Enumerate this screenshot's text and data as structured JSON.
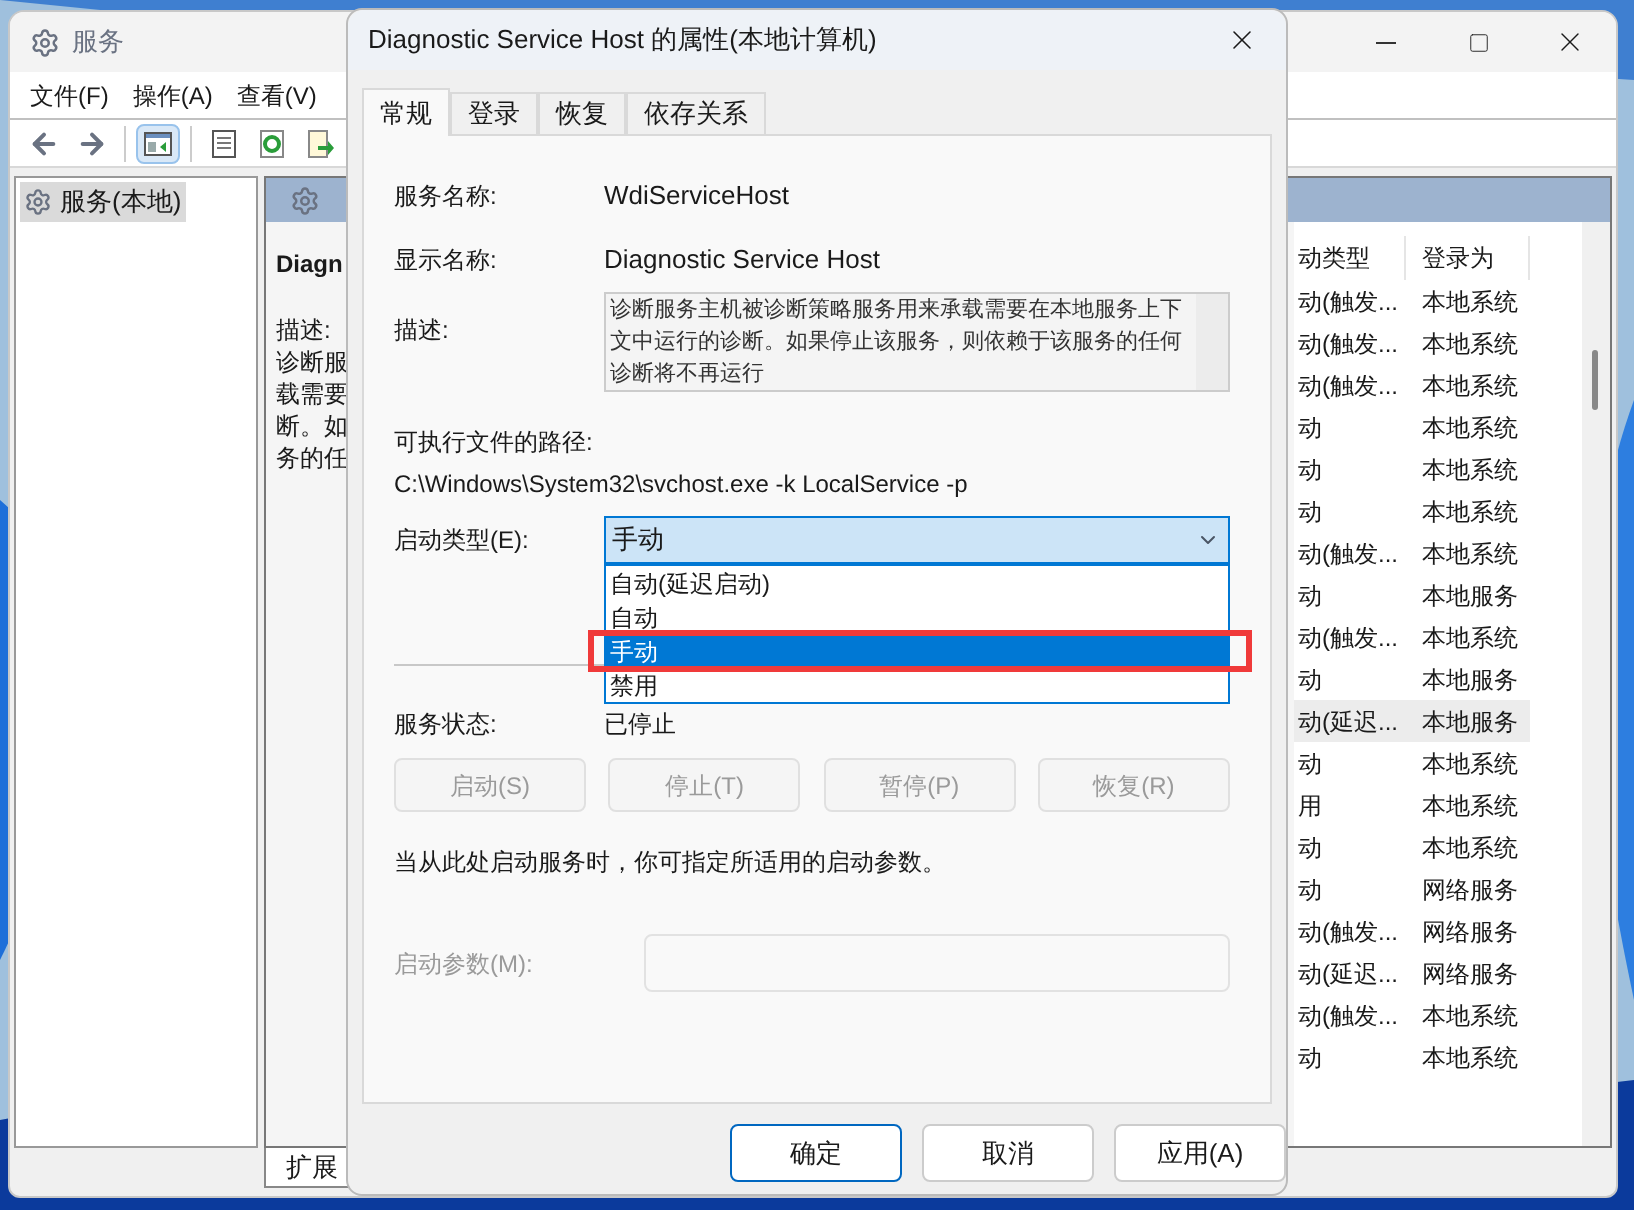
{
  "services_window": {
    "title": "服务",
    "menu": [
      "文件(F)",
      "操作(A)",
      "查看(V)"
    ],
    "toolbar": [
      {
        "kind": "back",
        "pressed": false
      },
      {
        "kind": "forward",
        "pressed": false
      },
      {
        "kind": "tree",
        "pressed": true
      },
      {
        "kind": "properties",
        "pressed": false
      },
      {
        "kind": "refresh",
        "pressed": false
      },
      {
        "kind": "export",
        "pressed": false
      }
    ],
    "tree": [
      {
        "label": "服务(本地)",
        "selected": true
      }
    ],
    "detail": {
      "title": "Diagn",
      "lines": [
        "描述:",
        "诊断服",
        "载需要",
        "断。如",
        "务的任"
      ]
    },
    "list": {
      "columns": [
        "动类型",
        "登录为"
      ],
      "rows": [
        {
          "column_1": "动(触发...",
          "logon": "本地系统",
          "selected": false
        },
        {
          "column_1": "动(触发...",
          "logon": "本地系统",
          "selected": false
        },
        {
          "column_1": "动(触发...",
          "logon": "本地系统",
          "selected": false
        },
        {
          "column_1": "动",
          "logon": "本地系统",
          "selected": false
        },
        {
          "column_1": "动",
          "logon": "本地系统",
          "selected": false
        },
        {
          "column_1": "动",
          "logon": "本地系统",
          "selected": false
        },
        {
          "column_1": "动(触发...",
          "logon": "本地系统",
          "selected": false
        },
        {
          "column_1": "动",
          "logon": "本地服务",
          "selected": false
        },
        {
          "column_1": "动(触发...",
          "logon": "本地系统",
          "selected": false
        },
        {
          "column_1": "动",
          "logon": "本地服务",
          "selected": false
        },
        {
          "column_1": "动(延迟...",
          "logon": "本地服务",
          "selected": true
        },
        {
          "column_1": "动",
          "logon": "本地系统",
          "selected": false
        },
        {
          "column_1": "用",
          "logon": "本地系统",
          "selected": false
        },
        {
          "column_1": "动",
          "logon": "本地系统",
          "selected": false
        },
        {
          "column_1": "动",
          "logon": "网络服务",
          "selected": false
        },
        {
          "column_1": "动(触发...",
          "logon": "网络服务",
          "selected": false
        },
        {
          "column_1": "动(延迟...",
          "logon": "网络服务",
          "selected": false
        },
        {
          "column_1": "动(触发...",
          "logon": "本地系统",
          "selected": false
        },
        {
          "column_1": "动",
          "logon": "本地系统",
          "selected": false
        }
      ]
    },
    "bottom_tabs": [
      {
        "label": "扩展",
        "selected": true
      }
    ]
  },
  "dialog": {
    "title": "Diagnostic Service Host 的属性(本地计算机)",
    "tabs": [
      {
        "label": "常规",
        "selected": true
      },
      {
        "label": "登录",
        "selected": false
      },
      {
        "label": "恢复",
        "selected": false
      },
      {
        "label": "依存关系",
        "selected": false
      }
    ],
    "service_name": {
      "label": "服务名称:",
      "value": "WdiServiceHost"
    },
    "display_name": {
      "label": "显示名称:",
      "value": "Diagnostic Service Host"
    },
    "description": {
      "label": "描述:",
      "value": "诊断服务主机被诊断策略服务用来承载需要在本地服务上下文中运行的诊断。如果停止该服务，则依赖于该服务的任何诊断将不再运行"
    },
    "path": {
      "label": "可执行文件的路径:",
      "value": "C:\\Windows\\System32\\svchost.exe -k LocalService -p"
    },
    "startup_type": {
      "label": "启动类型(E):",
      "value": "手动",
      "expanded": true,
      "options": [
        {
          "label": "自动(延迟启动)",
          "selected": false,
          "highlighted": false
        },
        {
          "label": "自动",
          "selected": false,
          "highlighted": false
        },
        {
          "label": "手动",
          "selected": true,
          "highlighted": true
        },
        {
          "label": "禁用",
          "selected": false,
          "highlighted": false
        }
      ]
    },
    "status": {
      "label": "服务状态:",
      "value": "已停止"
    },
    "service_buttons": [
      {
        "label": "启动(S)",
        "disabled": true
      },
      {
        "label": "停止(T)",
        "disabled": true
      },
      {
        "label": "暂停(P)",
        "disabled": true
      },
      {
        "label": "恢复(R)",
        "disabled": true
      }
    ],
    "hint": "当从此处启动服务时，你可指定所适用的启动参数。",
    "start_params": {
      "label": "启动参数(M):",
      "disabled": true
    },
    "buttons": [
      {
        "label": "确定",
        "default": true
      },
      {
        "label": "取消",
        "default": false
      },
      {
        "label": "应用(A)",
        "default": false
      }
    ]
  }
}
